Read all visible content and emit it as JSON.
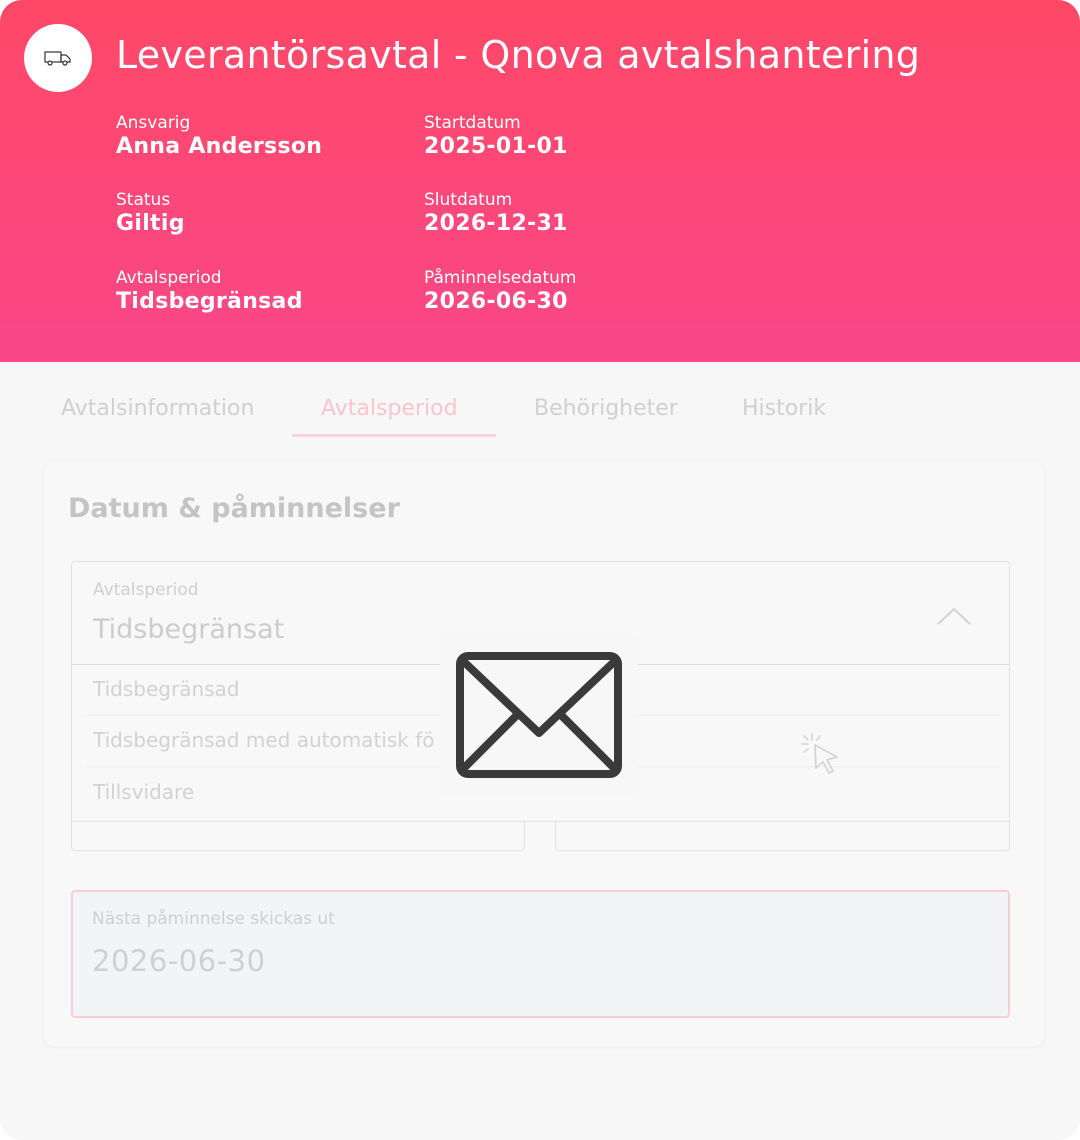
{
  "header": {
    "title": "Leverantörsavtal - Qnova avtalshantering",
    "logo_icon": "truck-icon",
    "fields": {
      "responsible": {
        "label": "Ansvarig",
        "value": "Anna Andersson"
      },
      "status": {
        "label": "Status",
        "value": "Giltig"
      },
      "period": {
        "label": "Avtalsperiod",
        "value": "Tidsbegränsad"
      },
      "start": {
        "label": "Startdatum",
        "value": "2025-01-01"
      },
      "end": {
        "label": "Slutdatum",
        "value": "2026-12-31"
      },
      "reminder": {
        "label": "Påminnelsedatum",
        "value": "2026-06-30"
      }
    },
    "gradient": [
      "#ff4867",
      "#fa4788"
    ]
  },
  "tabs": [
    {
      "label": "Avtalsinformation",
      "active": false
    },
    {
      "label": "Avtalsperiod",
      "active": true
    },
    {
      "label": "Behörigheter",
      "active": false
    },
    {
      "label": "Historik",
      "active": false
    }
  ],
  "section": {
    "title": "Datum & påminnelser",
    "period_select": {
      "label": "Avtalsperiod",
      "value": "Tidsbegränsat",
      "expanded": true,
      "options": [
        "Tidsbegränsad",
        "Tidsbegränsad med automatisk fö",
        "Tillsvidare"
      ]
    },
    "next_reminder": {
      "label": "Nästa påminnelse skickas ut",
      "value": "2026-06-30"
    }
  },
  "overlay_icon": "envelope-icon",
  "cursor_icon": "click-cursor-icon"
}
